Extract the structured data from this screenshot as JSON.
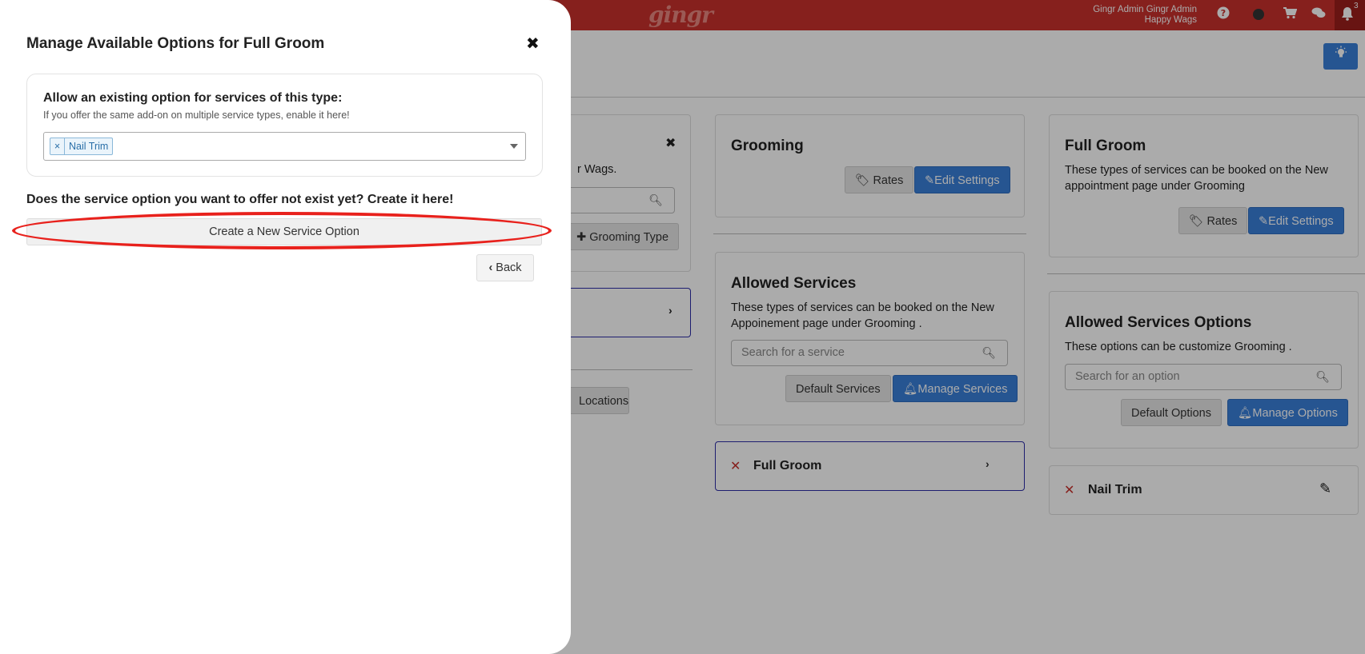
{
  "header": {
    "logo_text": "gingr",
    "user_name": "Gingr Admin Gingr Admin",
    "location": "Happy Wags",
    "notification_count": "3"
  },
  "left_column": {
    "partial_text": "r Wags.",
    "grooming_type_button": "Grooming Type",
    "locations_button": "Locations"
  },
  "grooming_card": {
    "title": "Grooming",
    "rates_button": "Rates",
    "edit_settings_button": "Edit Settings"
  },
  "full_groom_card": {
    "title": "Full Groom",
    "description": "These types of services can be booked on the New appointment page under Grooming",
    "rates_button": "Rates",
    "edit_settings_button": "Edit Settings"
  },
  "allowed_services": {
    "title": "Allowed Services",
    "description": "These types of services can be booked on the New Appoinement page under Grooming .",
    "search_placeholder": "Search for a service",
    "default_button": "Default Services",
    "manage_button": "Manage Services",
    "items": [
      {
        "name": "Full Groom"
      }
    ]
  },
  "allowed_options": {
    "title": "Allowed Services Options",
    "description": "These options can be customize Grooming .",
    "search_placeholder": "Search for an option",
    "default_button": "Default Options",
    "manage_button": "Manage Options",
    "items": [
      {
        "name": "Nail Trim"
      }
    ]
  },
  "modal": {
    "title": "Manage Available Options for Full Groom",
    "close_symbol": "✖",
    "existing_title": "Allow an existing option for services of this type:",
    "existing_subtitle": "If you offer the same add-on on multiple service types, enable it here!",
    "selected_tags": [
      "Nail Trim"
    ],
    "create_question": "Does the service option you want to offer not exist yet? Create it here!",
    "create_button": "Create a New Service Option",
    "back_button": "Back"
  },
  "colors": {
    "brand_red": "#c8302c",
    "primary_blue": "#3a7fd9",
    "highlight_ellipse": "#e8211c"
  }
}
